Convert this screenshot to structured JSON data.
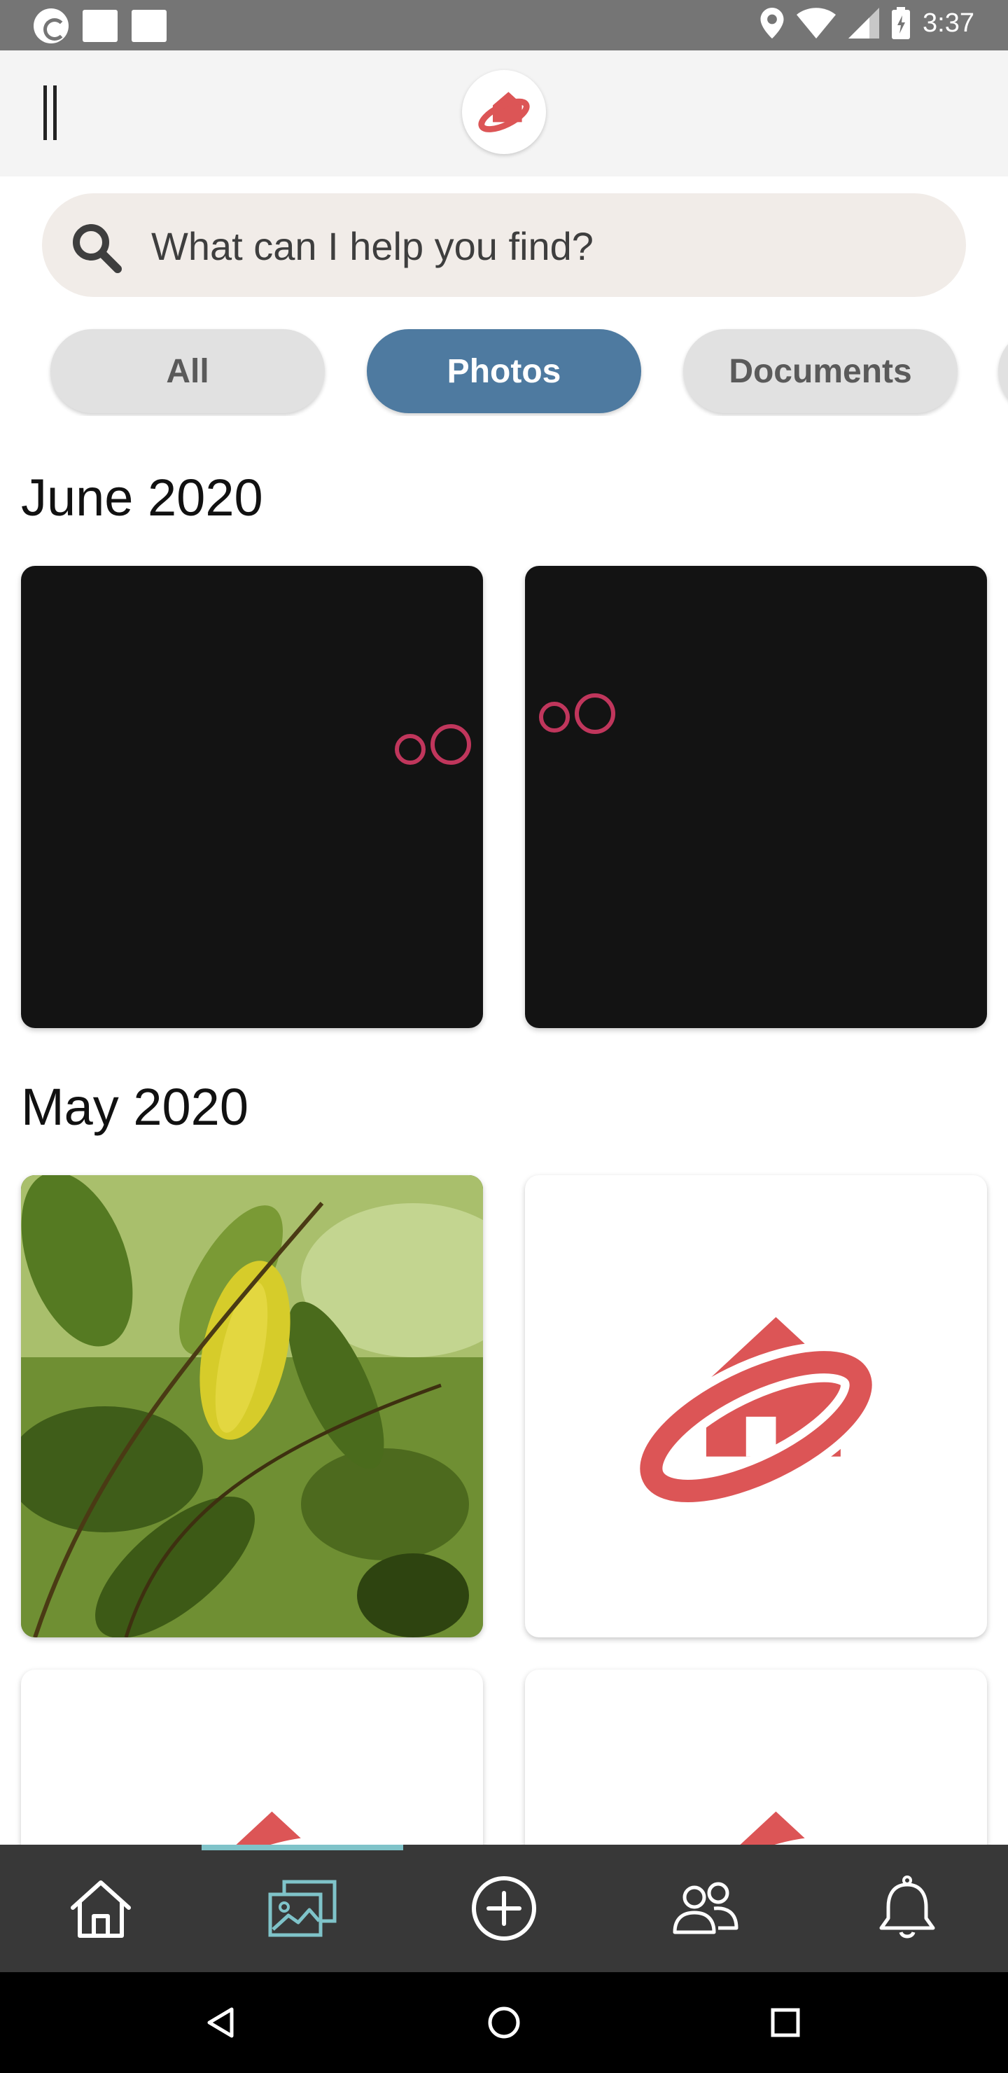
{
  "status_bar": {
    "time": "3:37"
  },
  "search": {
    "placeholder": "What can I help you find?"
  },
  "filters": [
    "All",
    "Photos",
    "Documents"
  ],
  "sections": [
    {
      "title": "June 2020"
    },
    {
      "title": "May 2020"
    }
  ],
  "colors": {
    "brand_red": "#dc5556",
    "chip_active": "#4e7aa0",
    "nav_active": "#7fc3c9",
    "nav_bg": "#383838"
  },
  "icons": {
    "bottom_nav": [
      "home-icon",
      "photos-icon",
      "add-icon",
      "people-icon",
      "bell-icon"
    ],
    "system_nav": [
      "back-icon",
      "home-circle-icon",
      "recents-icon"
    ]
  }
}
